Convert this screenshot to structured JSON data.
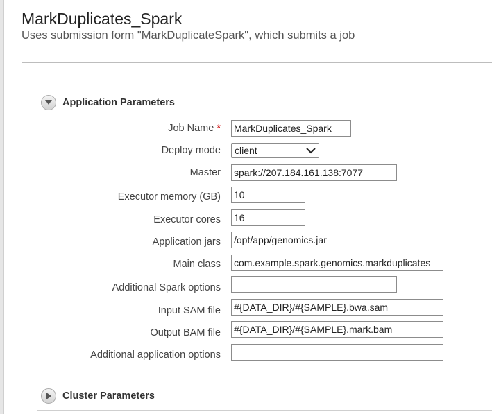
{
  "header": {
    "title": "MarkDuplicates_Spark",
    "subtitle": "Uses submission form \"MarkDuplicateSpark\", which submits a job"
  },
  "sections": {
    "application": {
      "label": "Application Parameters",
      "icon": "chevron-down-icon",
      "expanded": true
    },
    "cluster": {
      "label": "Cluster Parameters",
      "icon": "chevron-right-icon",
      "expanded": false
    }
  },
  "form": {
    "job_name": {
      "label": "Job Name",
      "required_mark": "*",
      "value": "MarkDuplicates_Spark"
    },
    "deploy_mode": {
      "label": "Deploy mode",
      "value": "client"
    },
    "master": {
      "label": "Master",
      "value": "spark://207.184.161.138:7077"
    },
    "executor_memory": {
      "label": "Executor memory (GB)",
      "value": "10"
    },
    "executor_cores": {
      "label": "Executor cores",
      "value": "16"
    },
    "application_jars": {
      "label": "Application jars",
      "value": "/opt/app/genomics.jar"
    },
    "main_class": {
      "label": "Main class",
      "value": "com.example.spark.genomics.markduplicates"
    },
    "additional_spark_options": {
      "label": "Additional Spark options",
      "value": ""
    },
    "input_sam_file": {
      "label": "Input SAM file",
      "value": "#{DATA_DIR}/#{SAMPLE}.bwa.sam"
    },
    "output_bam_file": {
      "label": "Output BAM file",
      "value": "#{DATA_DIR}/#{SAMPLE}.mark.bam"
    },
    "additional_application_options": {
      "label": "Additional application options",
      "value": ""
    }
  },
  "colors": {
    "required": "#cc0000",
    "field_border": "#8c8c8c",
    "divider": "#cfcfcf"
  }
}
